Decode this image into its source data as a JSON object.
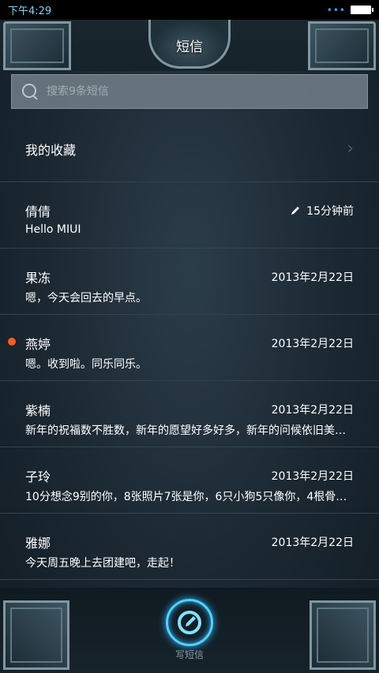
{
  "status_bar": {
    "time": "下午4:29",
    "signal": "•••"
  },
  "header": {
    "title": "短信"
  },
  "search": {
    "placeholder": "搜索9条短信"
  },
  "favorites": {
    "label": "我的收藏"
  },
  "messages": [
    {
      "name": "倩倩",
      "date": "15分钟前",
      "preview": "Hello MIUI",
      "draft": true,
      "unread": false
    },
    {
      "name": "果冻",
      "date": "2013年2月22日",
      "preview": "嗯，今天会回去的早点。",
      "draft": false,
      "unread": false
    },
    {
      "name": "燕婷",
      "date": "2013年2月22日",
      "preview": "嗯。收到啦。同乐同乐。",
      "draft": false,
      "unread": true
    },
    {
      "name": "紫楠",
      "date": "2013年2月22日",
      "preview": "新年的祝福数不胜数，新年的愿望好多好多，新年的问候依旧美…",
      "draft": false,
      "unread": false
    },
    {
      "name": "子玲",
      "date": "2013年2月22日",
      "preview": "10分想念9别的你，8张照片7张是你，6只小狗5只像你，4根骨…",
      "draft": false,
      "unread": false
    },
    {
      "name": "雅娜",
      "date": "2013年2月22日",
      "preview": "今天周五晚上去团建吧，走起！",
      "draft": false,
      "unread": false
    }
  ],
  "footer": {
    "compose_label": "写短信"
  },
  "colors": {
    "accent": "#4fd3ff",
    "unread": "#ff5a1f"
  }
}
